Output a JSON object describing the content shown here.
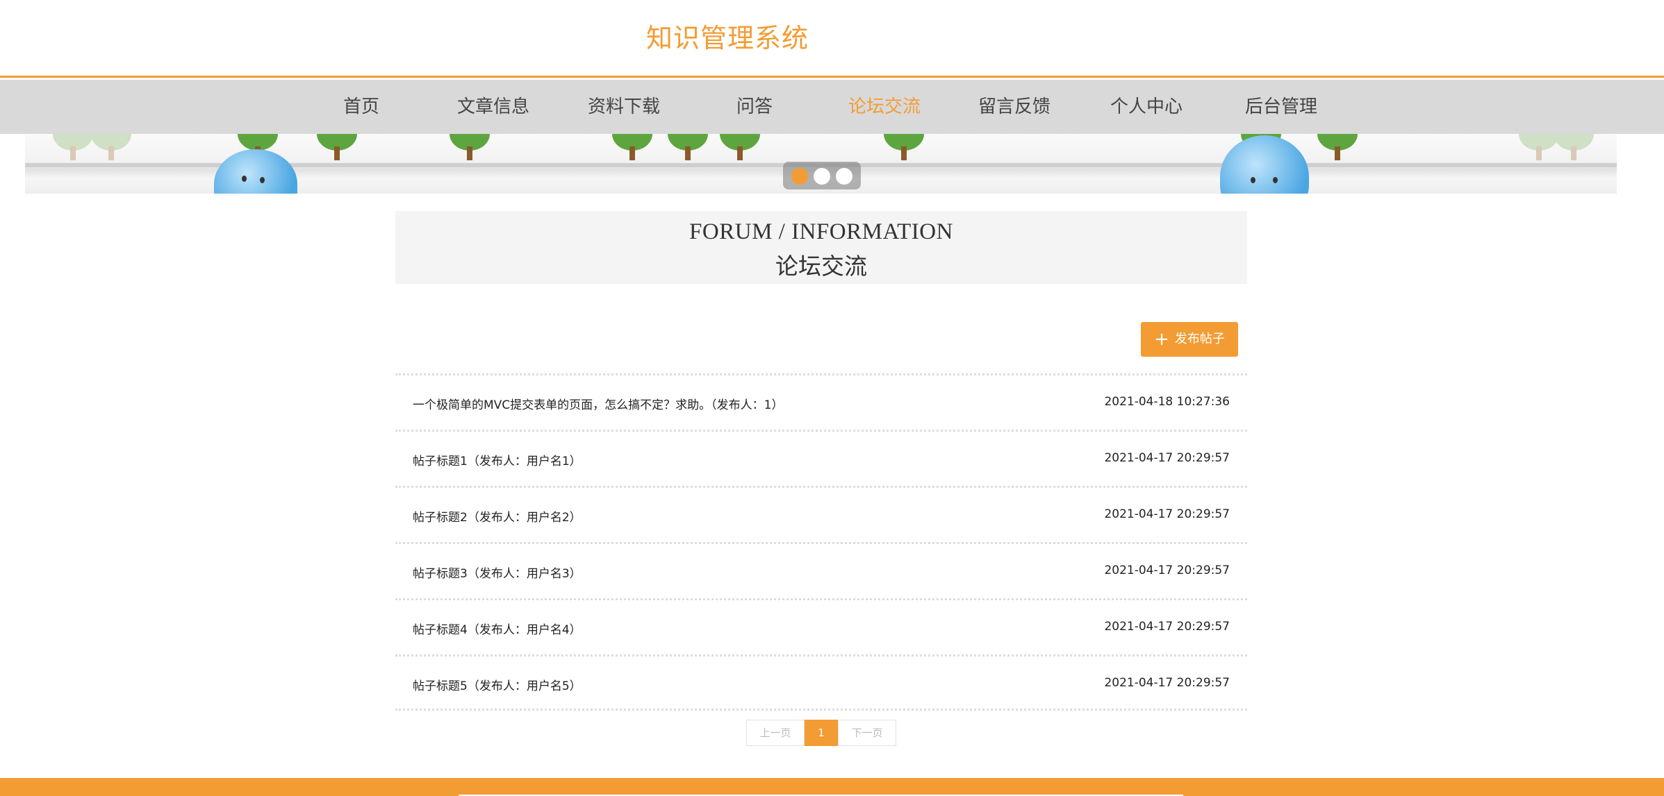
{
  "header": {
    "site_title": "知识管理系统"
  },
  "nav": {
    "items": [
      {
        "label": "首页"
      },
      {
        "label": "文章信息"
      },
      {
        "label": "资料下载"
      },
      {
        "label": "问答"
      },
      {
        "label": "论坛交流"
      },
      {
        "label": "留言反馈"
      },
      {
        "label": "个人中心"
      },
      {
        "label": "后台管理"
      }
    ],
    "active_index": 4
  },
  "banner": {
    "slide_count": 3,
    "active_slide": 0
  },
  "section": {
    "title_en": "FORUM / INFORMATION",
    "title_cn": "论坛交流"
  },
  "toolbar": {
    "publish_label": "发布帖子",
    "publish_icon": "plus-icon"
  },
  "posts": [
    {
      "title": "一个极简单的MVC提交表单的页面，怎么搞不定？求助。（发布人：1）",
      "time": "2021-04-18 10:27:36"
    },
    {
      "title": "帖子标题1（发布人：用户名1）",
      "time": "2021-04-17 20:29:57"
    },
    {
      "title": "帖子标题2（发布人：用户名2）",
      "time": "2021-04-17 20:29:57"
    },
    {
      "title": "帖子标题3（发布人：用户名3）",
      "time": "2021-04-17 20:29:57"
    },
    {
      "title": "帖子标题4（发布人：用户名4）",
      "time": "2021-04-17 20:29:57"
    },
    {
      "title": "帖子标题5（发布人：用户名5）",
      "time": "2021-04-17 20:29:57"
    }
  ],
  "pagination": {
    "prev_label": "上一页",
    "current": "1",
    "next_label": "下一页"
  },
  "colors": {
    "accent": "#f39c33",
    "nav_bg": "#d9d9d9",
    "section_bg": "#f4f4f4"
  }
}
